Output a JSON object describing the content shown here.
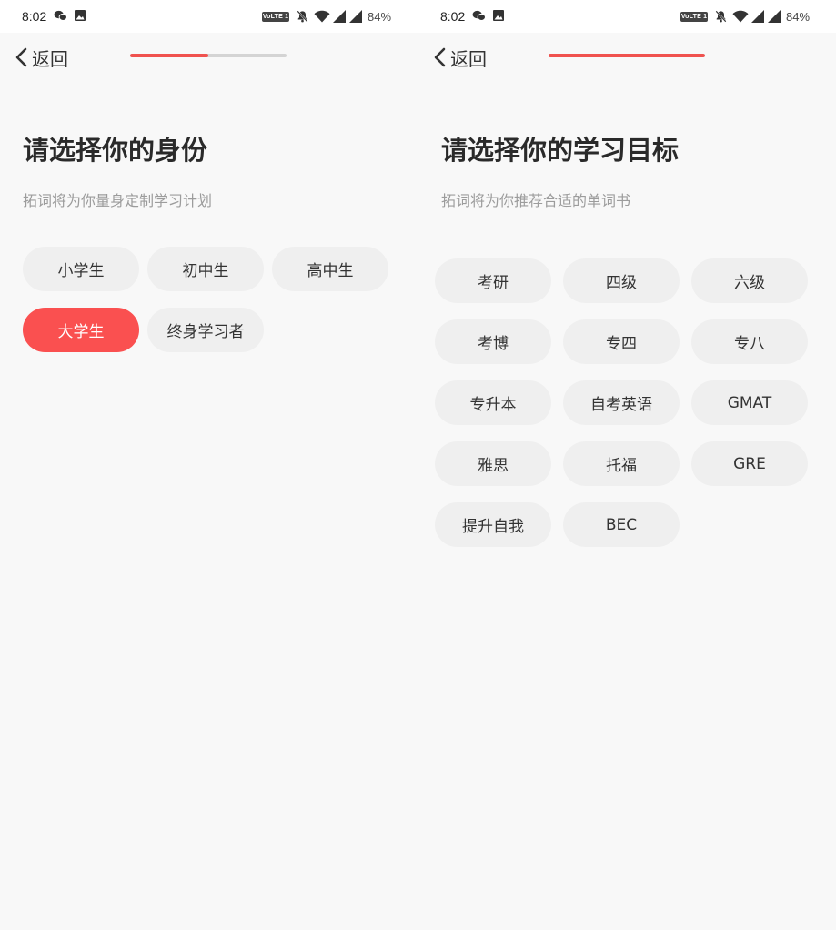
{
  "status_bar": {
    "time": "8:02",
    "volte": "VoLTE 1",
    "battery": "84%"
  },
  "icons": {
    "wechat": "wechat-icon",
    "image": "image-icon",
    "mute": "notifications-muted-icon",
    "wifi": "wifi-icon",
    "signal": "signal-icon",
    "back": "chevron-left-icon"
  },
  "colors": {
    "accent": "#fa5050",
    "progress": "#f0524f",
    "chip_bg": "#efefef",
    "background": "#f8f8f8"
  },
  "left_screen": {
    "back_label": "返回",
    "progress": 0.5,
    "title": "请选择你的身份",
    "subtitle": "拓词将为你量身定制学习计划",
    "options": [
      {
        "label": "小学生",
        "selected": false
      },
      {
        "label": "初中生",
        "selected": false
      },
      {
        "label": "高中生",
        "selected": false
      },
      {
        "label": "大学生",
        "selected": true
      },
      {
        "label": "终身学习者",
        "selected": false
      }
    ]
  },
  "right_screen": {
    "back_label": "返回",
    "progress": 1.0,
    "title": "请选择你的学习目标",
    "subtitle": "拓词将为你推荐合适的单词书",
    "options": [
      {
        "label": "考研",
        "selected": false
      },
      {
        "label": "四级",
        "selected": false
      },
      {
        "label": "六级",
        "selected": false
      },
      {
        "label": "考博",
        "selected": false
      },
      {
        "label": "专四",
        "selected": false
      },
      {
        "label": "专八",
        "selected": false
      },
      {
        "label": "专升本",
        "selected": false
      },
      {
        "label": "自考英语",
        "selected": false
      },
      {
        "label": "GMAT",
        "selected": false
      },
      {
        "label": "雅思",
        "selected": false
      },
      {
        "label": "托福",
        "selected": false
      },
      {
        "label": "GRE",
        "selected": false
      },
      {
        "label": "提升自我",
        "selected": false
      },
      {
        "label": "BEC",
        "selected": false
      }
    ]
  }
}
